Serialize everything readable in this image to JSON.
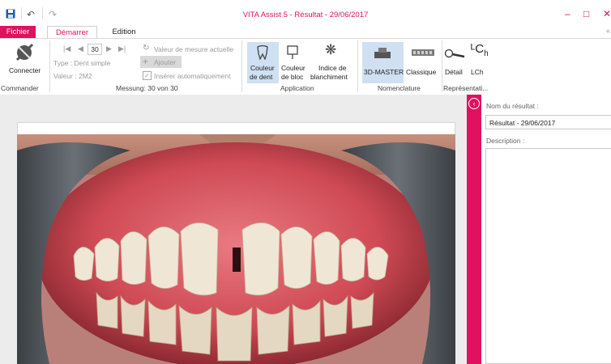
{
  "window": {
    "title": "VITA Assist 5 - Résultat - 29/06/2017",
    "minimize": "–",
    "maximize": "□",
    "close": "✕"
  },
  "tabs": {
    "fichier": "Fichier",
    "demarrer": "Démarrer",
    "edition": "Edition"
  },
  "ribbon": {
    "connecter": "Connecter",
    "counter": "30",
    "type": "Type :  Dent simple",
    "valeur": "Valeur : 2M2",
    "valeur_mesure": "Valeur de mesure actuelle",
    "ajouter": "Ajouter",
    "inserer": "Insérer automatiquement",
    "couleur_dent": [
      "Couleur",
      "de dent"
    ],
    "couleur_bloc": [
      "Couleur",
      "de bloc"
    ],
    "indice": [
      "Indice de",
      "blanchiment"
    ],
    "master": "3D-MASTER",
    "classique": "Classique",
    "detail": "Détail",
    "lch": "LCh",
    "groups": {
      "commander": "Commander",
      "messung": "Messung: 30 von 30",
      "application": "Application",
      "nomenclature": "Nomenclature",
      "representation": "Représentati..."
    }
  },
  "panel": {
    "nom_label": "Nom du résultat :",
    "nom_value": "Résultat - 29/06/2017",
    "desc_label": "Description :",
    "desc_value": ""
  },
  "colors": {
    "accent": "#e0115f",
    "selected": "#cfe0f2",
    "toolbar_blue": "#1b5fa8"
  }
}
